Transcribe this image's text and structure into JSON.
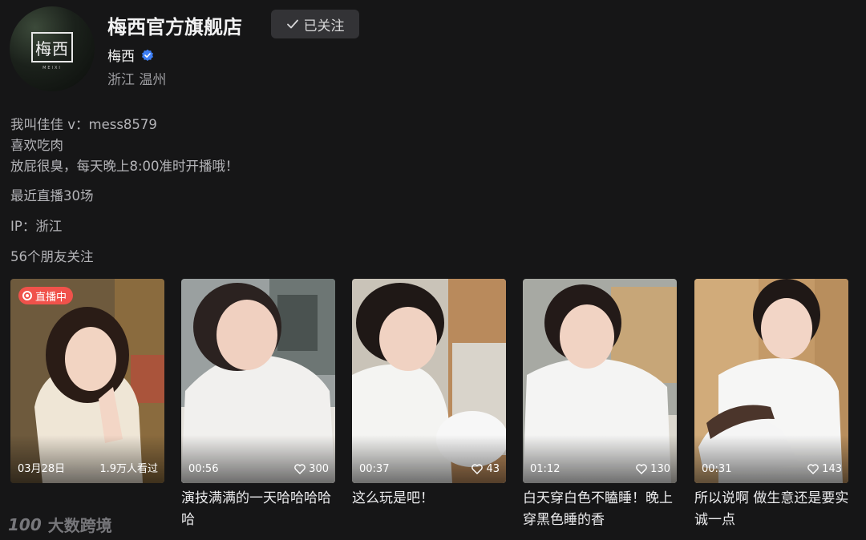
{
  "profile": {
    "shop_name": "梅西官方旗舰店",
    "follow_label": "已关注",
    "nickname": "梅西",
    "location": "浙江 温州",
    "avatar_text": "梅西",
    "avatar_subtext": "MEIXI"
  },
  "bio": {
    "lines": [
      "我叫佳佳 v：mess8579",
      "喜欢吃肉",
      "放屁很臭，每天晚上8:00准时开播哦！"
    ],
    "live_count": "最近直播30场",
    "ip": "IP：浙江",
    "friends": "56个朋友关注"
  },
  "videos": [
    {
      "badge": "直播中",
      "date": "03月28日",
      "views": "1.9万人看过",
      "caption": ""
    },
    {
      "duration": "00:56",
      "likes": "300",
      "caption": "演技满满的一天哈哈哈哈哈"
    },
    {
      "duration": "00:37",
      "likes": "43",
      "caption": "这么玩是吧！"
    },
    {
      "duration": "01:12",
      "likes": "130",
      "caption": "白天穿白色不瞌睡！晚上穿黑色睡的香"
    },
    {
      "duration": "00:31",
      "likes": "143",
      "caption": "所以说啊 做生意还是要实诚一点"
    }
  ],
  "watermark": {
    "logo": "100",
    "text": "大数跨境"
  },
  "colors": {
    "background": "#161617",
    "live_badge": "#f0524b",
    "verified": "#3d7ef5"
  },
  "icons": [
    "check-icon",
    "verified-icon",
    "heart-icon",
    "live-icon"
  ]
}
